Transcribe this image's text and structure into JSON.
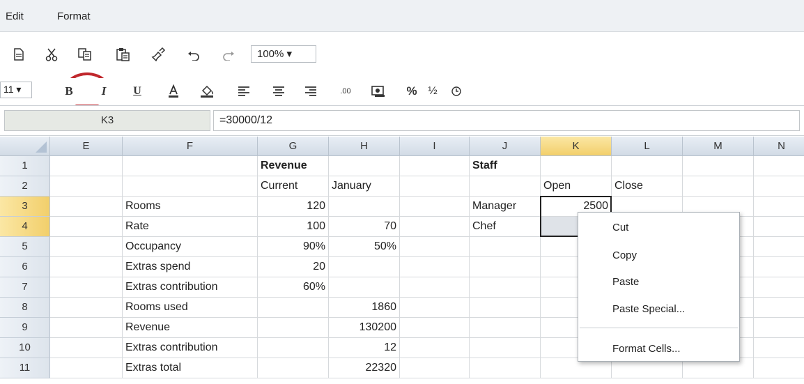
{
  "menu": {
    "edit": "Edit",
    "format": "Format"
  },
  "toolbar": {
    "zoom": "100% ▾",
    "font_size": "11 ▾",
    "decimal_label": ".00",
    "percent_label": "%",
    "fraction_label": "½"
  },
  "formula_bar": {
    "cell_ref": "K3",
    "formula": "=30000/12"
  },
  "columns": [
    "E",
    "F",
    "G",
    "H",
    "I",
    "J",
    "K",
    "L",
    "M",
    "N"
  ],
  "rows": [
    "1",
    "2",
    "3",
    "4",
    "5",
    "6",
    "7",
    "8",
    "9",
    "10",
    "11"
  ],
  "cells": {
    "G1": "Revenue",
    "J1": "Staff",
    "G2": "Current",
    "H2": "January",
    "K2": "Open",
    "L2": "Close",
    "F3": "Rooms",
    "G3": "120",
    "J3": "Manager",
    "K3": "2500",
    "F4": "Rate",
    "G4": "100",
    "H4": "70",
    "J4": "Chef",
    "F5": "Occupancy",
    "G5": "90%",
    "H5": "50%",
    "F6": "Extras spend",
    "G6": "20",
    "F7": "Extras contribution",
    "G7": "60%",
    "F8": "Rooms used",
    "H8": "1860",
    "F9": "Revenue",
    "H9": "130200",
    "F10": "Extras contribution",
    "H10": "12",
    "F11": "Extras total",
    "H11": "22320"
  },
  "context_menu": {
    "cut": "Cut",
    "copy": "Copy",
    "paste": "Paste",
    "paste_special": "Paste Special...",
    "format_cells": "Format Cells..."
  },
  "colors": {
    "selection_header": "#f2cf6b",
    "highlight_circle": "#c0282d"
  }
}
